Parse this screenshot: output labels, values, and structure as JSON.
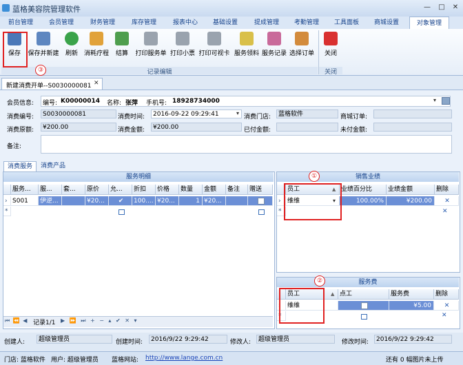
{
  "window": {
    "title": "蓝格美容院管理软件",
    "controls": [
      "—",
      "□",
      "✕"
    ]
  },
  "menu_tabs": [
    "前台管理",
    "会员管理",
    "财务管理",
    "库存管理",
    "报表中心",
    "基础设置",
    "提成管理",
    "考勤管理",
    "工具面板",
    "商城设置",
    "对象管理"
  ],
  "ribbon": {
    "buttons": [
      "保存",
      "保存并新建",
      "刷新",
      "消耗疗程",
      "结算",
      "打印服务单",
      "打印小票",
      "打印可视卡",
      "服务领料",
      "服务记录",
      "选择订单"
    ],
    "group_edit": "记录编辑",
    "close_label": "关闭",
    "group_close": "关闭"
  },
  "annotations": [
    "①",
    "②",
    "③"
  ],
  "doc_tab": {
    "title": "新建消费开单--S0030000081",
    "close": "✕"
  },
  "form": {
    "member_info_label": "会员信息:",
    "member_no_label": "编号:",
    "member_no": "K00000014",
    "name_label": "名称:",
    "name": "张萍",
    "phone_label": "手机号:",
    "phone": "18928734000",
    "consume_no_label": "消费编号:",
    "consume_no": "S0030000081",
    "consume_time_label": "消费时间:",
    "consume_time": "2016-09-22 09:29:41",
    "store_label": "消费门店:",
    "store": "蓝格软件",
    "mall_order_label": "商城订单:",
    "mall_order": "",
    "original_amount_label": "消费原额:",
    "original_amount": "¥200.00",
    "amount_label": "消费金额:",
    "amount": "¥200.00",
    "paid_label": "已付金额:",
    "paid": "",
    "unpaid_label": "未付金额:",
    "unpaid": "",
    "remark_label": "备注:"
  },
  "sub_tabs": [
    "消费服务",
    "消费产品"
  ],
  "service_grid": {
    "title": "服务明细",
    "columns": [
      "服务...",
      "服...",
      "套...",
      "原价",
      "允...",
      "折扣",
      "价格",
      "数量",
      "金额",
      "备注",
      "赠送"
    ],
    "row": [
      "S001",
      "伊逆...",
      "",
      "¥20...",
      "✔",
      "100....",
      "¥20...",
      "1",
      "¥20...",
      "",
      ""
    ]
  },
  "pager": {
    "label": "记录1/1",
    "buttons": [
      "⏮",
      "⏪",
      "◀",
      "▶",
      "⏩",
      "⏭",
      "+",
      "−",
      "▴",
      "✔",
      "✕",
      "▾"
    ]
  },
  "sales_grid": {
    "title": "销售业绩",
    "columns": [
      "员工",
      "业绩百分比",
      "业绩金额",
      "删除"
    ],
    "row": [
      "维维",
      "100.00%",
      "¥200.00",
      "✕"
    ]
  },
  "fee_grid": {
    "title": "服务费",
    "columns": [
      "员工",
      "点工",
      "服务费",
      "删除"
    ],
    "row": [
      "维维",
      "",
      "¥5.00",
      "✕"
    ]
  },
  "footer": {
    "creator_label": "创建人:",
    "creator": "超级管理员",
    "create_time_label": "创建时间:",
    "create_time": "2016/9/22 9:29:42",
    "modifier_label": "修改人:",
    "modifier": "超级管理员",
    "modify_time_label": "修改时间:",
    "modify_time": "2016/9/22 9:29:42"
  },
  "status_bar": {
    "store_label": "门店: 蓝格软件",
    "user_label": "用户: 超级管理员",
    "site_label": "蓝格网站:",
    "site_url": "http://www.lange.com.cn",
    "upload_status": "还有 0 幅图片未上传"
  },
  "colors": {
    "accent": "#15428b",
    "annotation": "#e02020",
    "selection": "#6b8fd6"
  }
}
